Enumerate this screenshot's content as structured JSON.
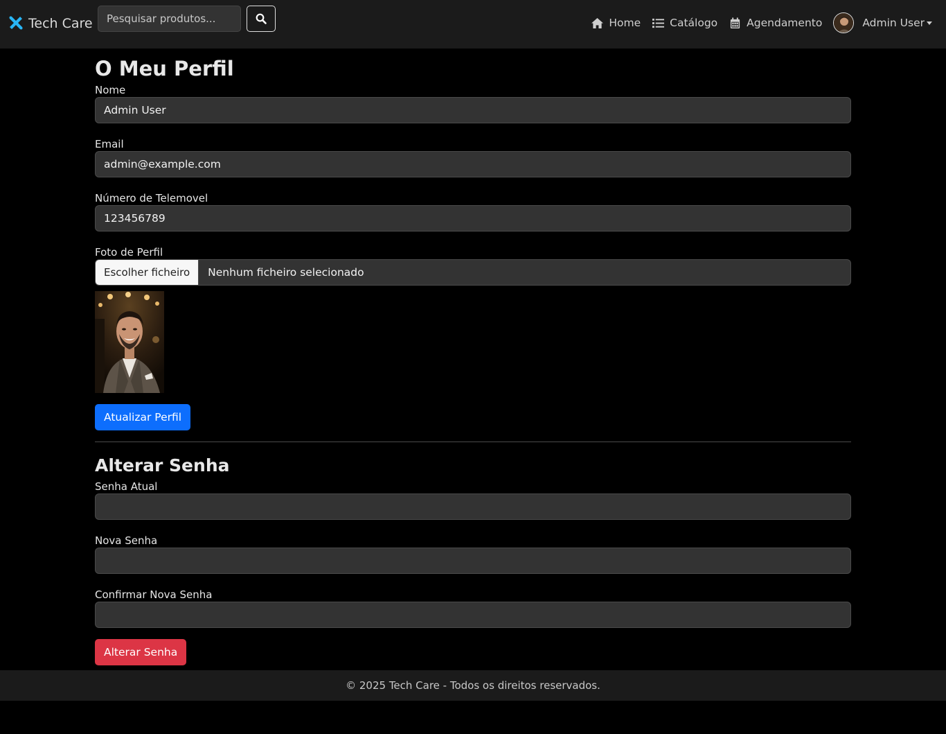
{
  "navbar": {
    "brand": "Tech Care",
    "search_placeholder": "Pesquisar produtos...",
    "links": {
      "home": "Home",
      "catalogo": "Catálogo",
      "agendamento": "Agendamento"
    },
    "user_name": "Admin User"
  },
  "profile": {
    "title": "O Meu Perfil",
    "name_label": "Nome",
    "name_value": "Admin User",
    "email_label": "Email",
    "email_value": "admin@example.com",
    "phone_label": "Número de Telemovel",
    "phone_value": "123456789",
    "photo_label": "Foto de Perfil",
    "file_button": "Escolher ficheiro",
    "file_status": "Nenhum ficheiro selecionado",
    "submit": "Atualizar Perfil"
  },
  "password": {
    "title": "Alterar Senha",
    "current_label": "Senha Atual",
    "new_label": "Nova Senha",
    "confirm_label": "Confirmar Nova Senha",
    "submit": "Alterar Senha"
  },
  "footer": {
    "text": "© 2025 Tech Care - Todos os direitos reservados."
  },
  "colors": {
    "primary": "#0d6efd",
    "danger": "#dc3545",
    "navbar_bg": "#1b1b1b",
    "input_bg": "#333333",
    "brand_icon": "#29b6f6"
  }
}
